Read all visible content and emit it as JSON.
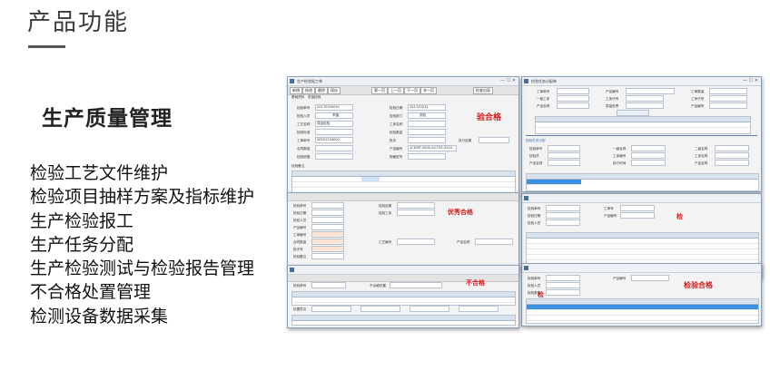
{
  "slide": {
    "title": "产品功能",
    "section_heading": "生产质量管理",
    "features": [
      "检验工艺文件维护",
      "检验项目抽样方案及指标维护",
      "生产检验报工",
      "生产任务分配",
      "生产检验测试与检验报告管理",
      "不合格处置管理",
      "检测设备数据采集"
    ]
  },
  "screenshots": {
    "main_window": {
      "title": "生产检验报工单",
      "tabs": [
        "基础资料",
        "质量检验"
      ],
      "toolbar": [
        "新增",
        "修改",
        "删除",
        "查看",
        "保存",
        "第一页",
        "上一页",
        "下一页",
        "末一页",
        "打印",
        "检查出现"
      ],
      "fields": {
        "inspection_no_label": "检验单号",
        "inspection_no": "20170330001",
        "inspector_label": "检验人员",
        "inspector": "李晶",
        "process_label": "工艺名称",
        "process": "成品检验",
        "work_order_label": "工单单号",
        "work_order": "2FK01200002",
        "inspection_date_label": "检验日期",
        "inspection_date": "2017/03/31",
        "department_label": "检验部门",
        "department": "质检",
        "product_code_label": "产品编号",
        "product_code": "1CDMT-0500-S4-TSS-0224",
        "stamp": "验合格"
      }
    },
    "upper_right_window": {
      "title": "检验任务分配单",
      "stamp": "检"
    },
    "middle_left_window": {
      "stamp": "优秀合格"
    },
    "lower_left_window": {
      "stamp": "不合格"
    },
    "lower_right_window": {
      "stamp": "检验合格",
      "extra_stamp": "检"
    }
  }
}
